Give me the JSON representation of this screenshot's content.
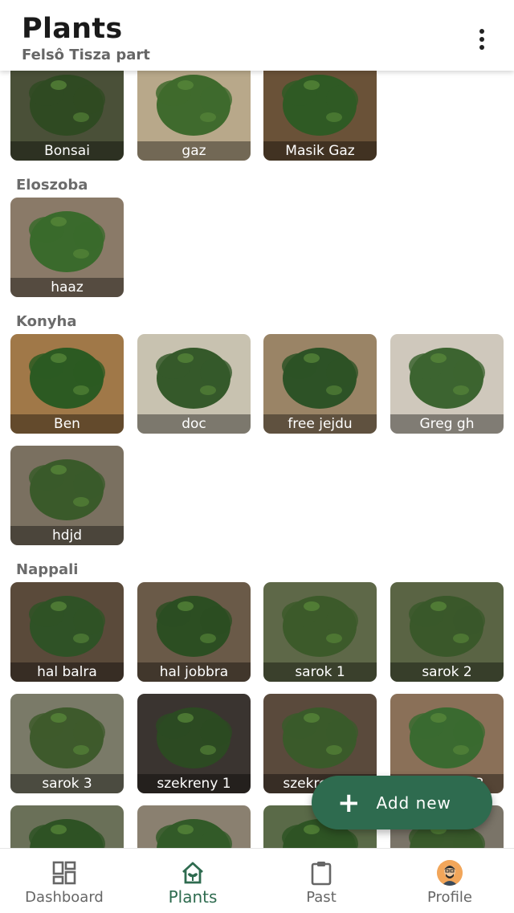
{
  "header": {
    "title": "Plants",
    "subtitle": "Felsô Tisza part"
  },
  "groups": [
    {
      "label": "",
      "plants": [
        {
          "name": "Bonsai",
          "bg": "#4a5038",
          "leaf": "#2f4a22"
        },
        {
          "name": "gaz",
          "bg": "#b8a88a",
          "leaf": "#3f6a2d"
        },
        {
          "name": "Masik Gaz",
          "bg": "#6a5238",
          "leaf": "#2f5a24"
        }
      ]
    },
    {
      "label": "Eloszoba",
      "plants": [
        {
          "name": "haaz",
          "bg": "#8a7a68",
          "leaf": "#3a6a2c"
        }
      ]
    },
    {
      "label": "Konyha",
      "plants": [
        {
          "name": "Ben",
          "bg": "#a07848",
          "leaf": "#2c5a22"
        },
        {
          "name": "doc",
          "bg": "#c8c2b0",
          "leaf": "#35592a"
        },
        {
          "name": "free jejdu",
          "bg": "#9a8466",
          "leaf": "#2d5226"
        },
        {
          "name": "Greg gh",
          "bg": "#cfc8bc",
          "leaf": "#3c6430"
        },
        {
          "name": "hdjd",
          "bg": "#7a7060",
          "leaf": "#3a5a2a"
        }
      ]
    },
    {
      "label": "Nappali",
      "plants": [
        {
          "name": "hal balra",
          "bg": "#5a4a3a",
          "leaf": "#2f5226"
        },
        {
          "name": "hal jobbra",
          "bg": "#6a5a48",
          "leaf": "#2c4e22"
        },
        {
          "name": "sarok 1",
          "bg": "#5e6848",
          "leaf": "#3c5a2a"
        },
        {
          "name": "sarok 2",
          "bg": "#5a6444",
          "leaf": "#3a582a"
        },
        {
          "name": "sarok 3",
          "bg": "#7a7a68",
          "leaf": "#3e5a2c"
        },
        {
          "name": "szekreny 1",
          "bg": "#3a3430",
          "leaf": "#2c4a22"
        },
        {
          "name": "szekreny 2",
          "bg": "#5a4a3c",
          "leaf": "#3a5a2a"
        },
        {
          "name": "szekreny 3",
          "bg": "#8a7058",
          "leaf": "#3a6a30"
        },
        {
          "name": "",
          "bg": "#6a7058",
          "leaf": "#2e5224"
        },
        {
          "name": "",
          "bg": "#8a8070",
          "leaf": "#325a28"
        },
        {
          "name": "",
          "bg": "#5a6a48",
          "leaf": "#2e5424"
        },
        {
          "name": "",
          "bg": "#7a7468",
          "leaf": "#3a5a2c"
        }
      ]
    }
  ],
  "fab": {
    "plus": "+",
    "label": "Add new"
  },
  "nav": {
    "dashboard": "Dashboard",
    "plants": "Plants",
    "past": "Past",
    "profile": "Profile",
    "active_color": "#2e6b4f",
    "inactive_color": "#666666"
  },
  "icons": {
    "menu": "more-vert-icon",
    "dashboard": "dashboard-grid-icon",
    "plants": "home-plant-icon",
    "past": "clipboard-icon",
    "profile": "avatar-icon"
  }
}
